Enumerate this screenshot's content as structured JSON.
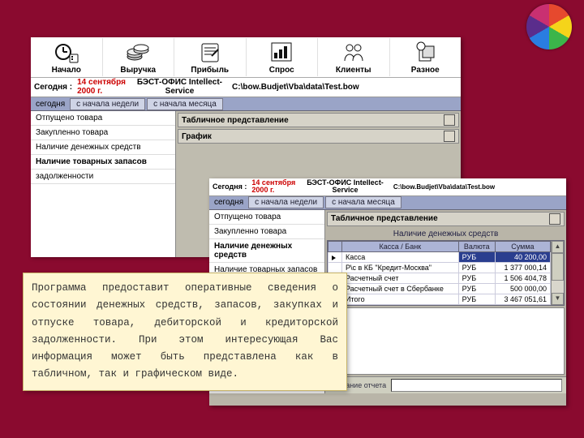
{
  "toolbar": {
    "items": [
      {
        "label": "Начало"
      },
      {
        "label": "Выручка"
      },
      {
        "label": "Прибыль"
      },
      {
        "label": "Спрос"
      },
      {
        "label": "Клиенты"
      },
      {
        "label": "Разное"
      }
    ]
  },
  "header": {
    "today_label": "Сегодня :",
    "date_line1": "14 сентября",
    "date_line2": "2000 г.",
    "app_line1": "БЭСТ-ОФИС Intellect-",
    "app_line2": "Service",
    "path": "C:\\bow.Budjet\\Vba\\data\\Test.bow"
  },
  "period_tabs": {
    "label": "сегодня",
    "tabs": [
      "с начала недели",
      "с начала месяца"
    ]
  },
  "left_items": [
    {
      "label": "Отпущено товара",
      "bold": false
    },
    {
      "label": "Закупленно товара",
      "bold": false
    },
    {
      "label": "Наличие денежных средств",
      "bold": false
    },
    {
      "label": "Наличие товарных запасов",
      "bold": true
    },
    {
      "label": "задолженности",
      "bold": false
    }
  ],
  "views": {
    "table": "Табличное представление",
    "chart": "График"
  },
  "left_items2": [
    {
      "label": "Отпущено товара",
      "bold": false
    },
    {
      "label": "Закупленно товара",
      "bold": false
    },
    {
      "label": "Наличие денежных средств",
      "bold": true
    },
    {
      "label": "Наличие товарных запасов",
      "bold": false
    }
  ],
  "view2": "Табличное представление",
  "table": {
    "title": "Наличие денежных средств",
    "cols": [
      "Касса / Банк",
      "Валюта",
      "Сумма"
    ],
    "rows": [
      {
        "kb": "Касса",
        "cur": "РУБ",
        "sum": "40 200,00",
        "sel": true
      },
      {
        "kb": "Р\\с в КБ \"Кредит-Москва\"",
        "cur": "РУБ",
        "sum": "1 377 000,14",
        "sel": false
      },
      {
        "kb": "Расчетный счет",
        "cur": "РУБ",
        "sum": "1 506 404,78",
        "sel": false
      },
      {
        "kb": "Расчетный счет в Сбербанке",
        "cur": "РУБ",
        "sum": "500 000,00",
        "sel": false
      },
      {
        "kb": "Итого",
        "cur": "РУБ",
        "sum": "3 467 051,61",
        "sel": false
      }
    ]
  },
  "footer": {
    "label": "Название отчета"
  },
  "note_text": "Программа предоставит оперативные сведения о состоянии денежных средств, запасов, закупках и отпуске товара, дебиторской и кредиторской задолженности. При этом интересующая Вас информация может быть представлена как в табличном, так и графическом виде."
}
